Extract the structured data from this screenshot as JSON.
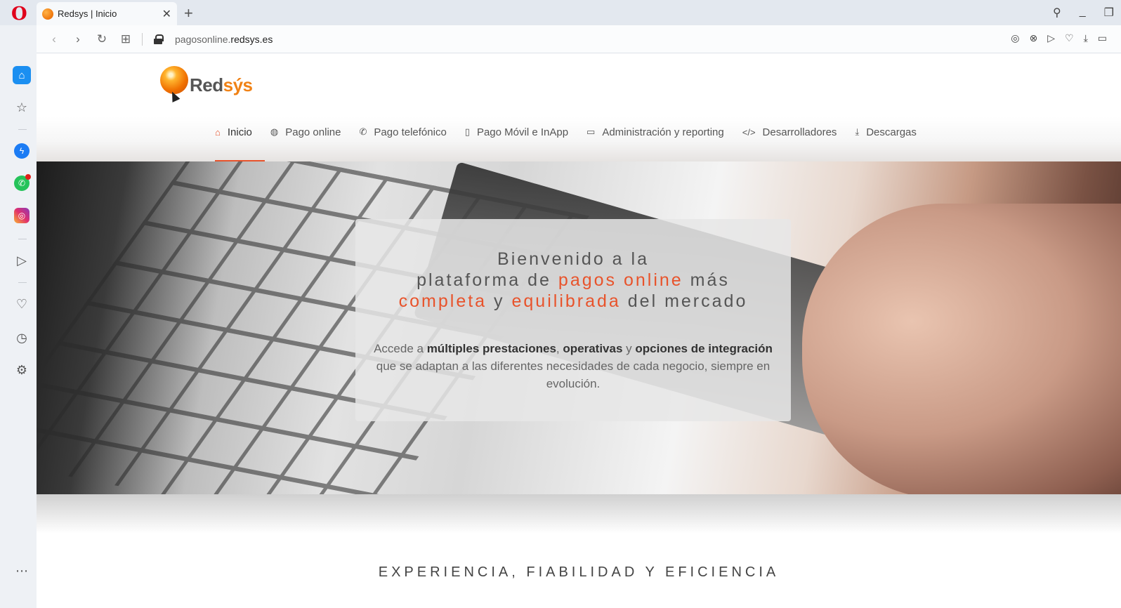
{
  "browser": {
    "tab_title": "Redsys | Inicio",
    "url_prefix": "pagosonline.",
    "url_domain": "redsys.es"
  },
  "brand": {
    "logo_main": "Red",
    "logo_accent": "sýs",
    "accent_color": "#e8532b"
  },
  "nav": {
    "items": [
      {
        "label": "Inicio",
        "icon": "home-icon",
        "active": true
      },
      {
        "label": "Pago online",
        "icon": "globe-icon"
      },
      {
        "label": "Pago telefónico",
        "icon": "phone-icon"
      },
      {
        "label": "Pago Móvil e InApp",
        "icon": "mobile-icon"
      },
      {
        "label": "Administración y reporting",
        "icon": "laptop-icon"
      },
      {
        "label": "Desarrolladores",
        "icon": "code-icon"
      },
      {
        "label": "Descargas",
        "icon": "download-icon"
      }
    ]
  },
  "welcome": {
    "line1": "Bienvenido a la",
    "line2_a": "plataforma de ",
    "line2_b": "pagos online",
    "line2_c": " más",
    "line3_a": "completa",
    "line3_b": " y ",
    "line3_c": "equilibrada",
    "line3_d": " del mercado",
    "desc_a": "Accede a ",
    "desc_b": "múltiples prestaciones",
    "desc_c": ", ",
    "desc_d": "operativas",
    "desc_e": " y ",
    "desc_f": "opciones de integración",
    "desc_g": " que se adaptan a las diferentes necesidades de cada negocio, siempre en evolución."
  },
  "tagline": "EXPERIENCIA, FIABILIDAD Y EFICIENCIA"
}
